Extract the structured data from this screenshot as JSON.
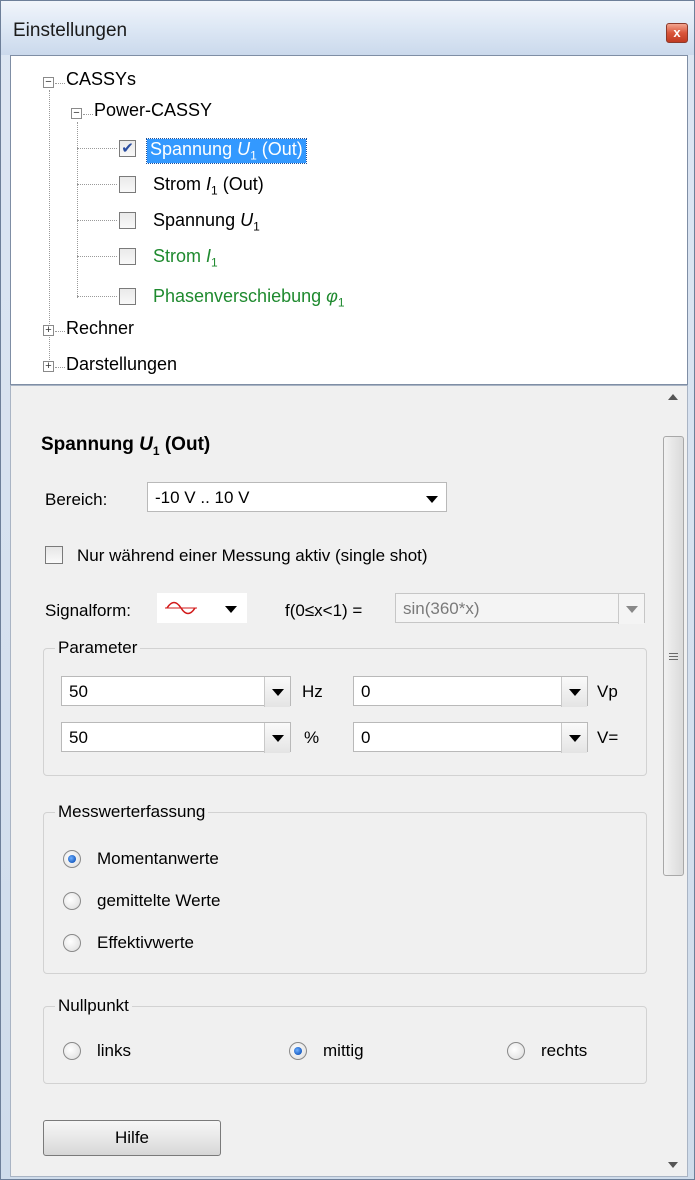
{
  "window": {
    "title": "Einstellungen",
    "close_glyph": "x"
  },
  "tree": {
    "root_cassys": "CASSYs",
    "power_cassy": "Power-CASSY",
    "items": [
      {
        "prefix": "Spannung ",
        "symbol": "U",
        "sub": "1",
        "suffix": " (Out)",
        "checked": true,
        "selected": true,
        "green": false
      },
      {
        "prefix": "Strom ",
        "symbol": "I",
        "sub": "1",
        "suffix": " (Out)",
        "checked": false,
        "selected": false,
        "green": false
      },
      {
        "prefix": "Spannung ",
        "symbol": "U",
        "sub": "1",
        "suffix": "",
        "checked": false,
        "selected": false,
        "green": false
      },
      {
        "prefix": "Strom ",
        "symbol": "I",
        "sub": "1",
        "suffix": "",
        "checked": false,
        "selected": false,
        "green": true
      },
      {
        "prefix": "Phasenverschiebung ",
        "symbol": "φ",
        "sub": "1",
        "suffix": "",
        "checked": false,
        "selected": false,
        "green": true
      }
    ],
    "rechner": "Rechner",
    "darstellungen": "Darstellungen"
  },
  "detail": {
    "heading_prefix": "Spannung ",
    "heading_symbol": "U",
    "heading_sub": "1",
    "heading_suffix": " (Out)",
    "bereich_label": "Bereich:",
    "bereich_value": "-10 V .. 10 V",
    "single_shot_label": "Nur während einer Messung aktiv (single shot)",
    "signalform_label": "Signalform:",
    "formula_label": "f(0≤x<1) =",
    "formula_value": "sin(360*x)",
    "parameter_title": "Parameter",
    "param1_value": "50",
    "param1_unit": "Hz",
    "param2_value": "0",
    "param2_unit": "Vp",
    "param3_value": "50",
    "param3_unit": "%",
    "param4_value": "0",
    "param4_unit": "V=",
    "messwert_title": "Messwerterfassung",
    "messwert_options": [
      "Momentanwerte",
      "gemittelte Werte",
      "Effektivwerte"
    ],
    "messwert_selected": "Momentanwerte",
    "nullpunkt_title": "Nullpunkt",
    "nullpunkt_options": [
      "links",
      "mittig",
      "rechts"
    ],
    "nullpunkt_selected": "mittig",
    "hilfe_label": "Hilfe"
  }
}
